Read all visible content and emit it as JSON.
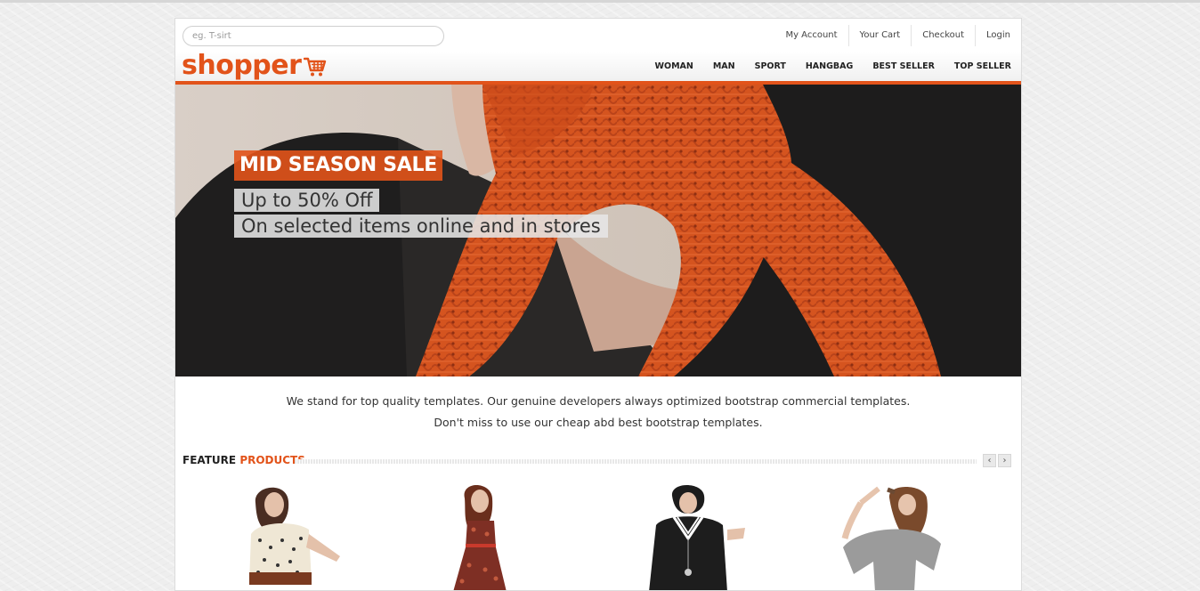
{
  "search": {
    "placeholder": "eg. T-sirt"
  },
  "account_links": [
    "My Account",
    "Your Cart",
    "Checkout",
    "Login"
  ],
  "logo": {
    "text": "shopper"
  },
  "menu": [
    "WOMAN",
    "MAN",
    "SPORT",
    "HANGBAG",
    "BEST SELLER",
    "TOP SELLER"
  ],
  "hero": {
    "title": "MID SEASON SALE",
    "line1": "Up to 50% Off",
    "line2": "On selected items online and in stores"
  },
  "tagline": {
    "line1": "We stand for top quality templates. Our genuine developers always optimized bootstrap commercial templates.",
    "line2": "Don't miss to use our cheap abd best bootstrap templates."
  },
  "featured": {
    "title_part1": "FEATURE",
    "title_part2": "PRODUCTS",
    "prev": "‹",
    "next": "›"
  },
  "colors": {
    "accent": "#e2531a"
  }
}
